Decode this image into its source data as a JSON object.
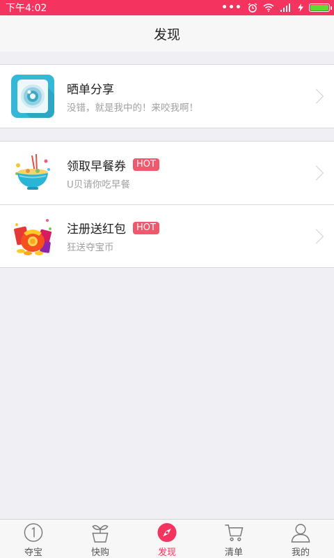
{
  "status_bar": {
    "time": "下午4:02"
  },
  "header": {
    "title": "发现"
  },
  "groups": [
    {
      "items": [
        {
          "title": "晒单分享",
          "subtitle": "没错，就是我中的！来咬我啊！",
          "badge": ""
        }
      ]
    },
    {
      "items": [
        {
          "title": "领取早餐券",
          "subtitle": "U贝请你吃早餐",
          "badge": "HOT"
        },
        {
          "title": "注册送红包",
          "subtitle": "狂送夺宝币",
          "badge": "HOT"
        }
      ]
    }
  ],
  "tabbar": {
    "tabs": [
      {
        "label": "夺宝",
        "icon": "number-one-circle-icon"
      },
      {
        "label": "快购",
        "icon": "sprout-pot-icon"
      },
      {
        "label": "发现",
        "icon": "compass-icon",
        "active": true
      },
      {
        "label": "清单",
        "icon": "shopping-cart-icon"
      },
      {
        "label": "我的",
        "icon": "user-icon"
      }
    ]
  },
  "colors": {
    "accent": "#f4345e",
    "hot_badge": "#f0586d",
    "battery": "#5fdc2d"
  }
}
